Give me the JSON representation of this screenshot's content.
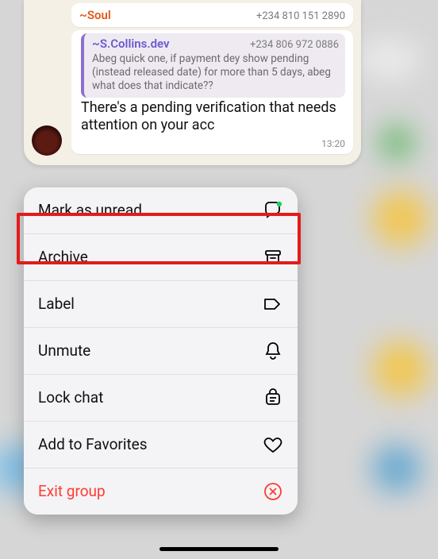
{
  "chat": {
    "contact1": {
      "name": "~Soul",
      "phone": "+234 810 151 2890"
    },
    "contact2": {
      "name": "~S.Collins.dev",
      "phone": "+234 806 972 0886",
      "quote": "Abeg quick one, if payment dey show pending (instead released date) for more than 5 days, abeg what does that indicate??"
    },
    "latest": "There's a pending verification that needs attention on your acc",
    "time": "13:20"
  },
  "menu": {
    "mark_unread": "Mark as unread",
    "archive": "Archive",
    "label": "Label",
    "unmute": "Unmute",
    "lock_chat": "Lock chat",
    "add_fav": "Add to Favorites",
    "exit_group": "Exit group"
  }
}
